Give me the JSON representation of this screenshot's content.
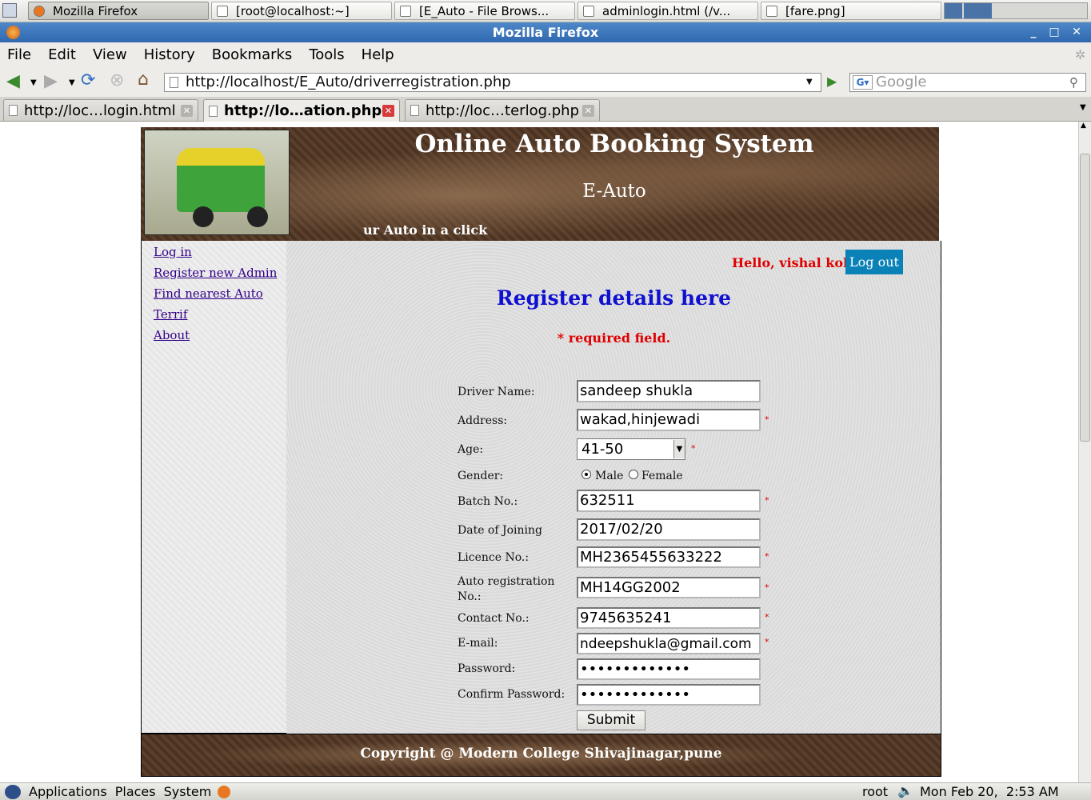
{
  "taskbar": {
    "windows": [
      "Mozilla Firefox",
      "[root@localhost:~]",
      "[E_Auto - File Brows...",
      "adminlogin.html (/v...",
      "[fare.png]"
    ]
  },
  "window": {
    "title": "Mozilla Firefox"
  },
  "menubar": {
    "items": [
      "File",
      "Edit",
      "View",
      "History",
      "Bookmarks",
      "Tools",
      "Help"
    ]
  },
  "toolbar": {
    "url": "http://localhost/E_Auto/driverregistration.php",
    "search_placeholder": "Google"
  },
  "tabs": [
    {
      "label": "http://loc…login.html"
    },
    {
      "label": "http://lo…ation.php"
    },
    {
      "label": "http://loc…terlog.php"
    }
  ],
  "page": {
    "site_title": "Online Auto Booking System",
    "brand": "E-Auto",
    "tagline": "ur Auto in a click",
    "sidebar": [
      "Log in",
      "Register new Admin",
      "Find nearest Auto",
      "Terrif",
      "About"
    ],
    "greeting": "Hello, vishal kokane",
    "logout": "Log out",
    "form_title": "Register details here",
    "required_note": "* required field.",
    "labels": {
      "driver_name": "Driver Name:",
      "address": "Address:",
      "age": "Age:",
      "gender": "Gender:",
      "batch": "Batch No.:",
      "doj": "Date of Joining",
      "licence": "Licence No.:",
      "auto_reg": "Auto registration No.:",
      "contact": "Contact No.:",
      "email": "E-mail:",
      "password": "Password:",
      "confirm": "Confirm Password:"
    },
    "values": {
      "driver_name": "sandeep shukla",
      "address": "wakad,hinjewadi",
      "age": "41-50",
      "batch": "632511",
      "doj": "2017/02/20",
      "licence": "MH2365455633222",
      "auto_reg": "MH14GG2002",
      "contact": "9745635241",
      "email": "ndeepshukla@gmail.com",
      "password": "•••••••••••••",
      "confirm": "•••••••••••••"
    },
    "gender_options": [
      "Male",
      "Female"
    ],
    "submit": "Submit",
    "star": "*",
    "copyright": "Copyright @ Modern College Shivajinagar,pune"
  },
  "panel": {
    "applications": "Applications",
    "places": "Places",
    "system": "System",
    "user": "root",
    "clock": "Mon Feb 20,  2:53 AM"
  }
}
